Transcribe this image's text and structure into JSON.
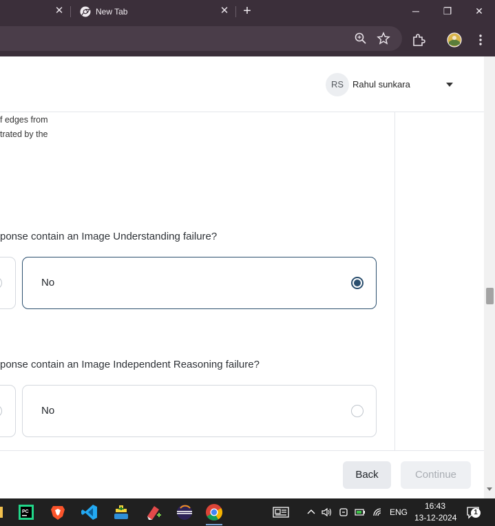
{
  "browser": {
    "tab_close_glyph": "✕",
    "active_tab_title": "New Tab",
    "new_tab_glyph": "+",
    "window_minimize_glyph": "─",
    "window_restore_glyph": "❐",
    "window_close_glyph": "✕",
    "toolbar_icons": [
      "zoom-icon",
      "bookmark-star-icon",
      "extensions-icon",
      "profile-avatar-icon",
      "menu-kebab-icon"
    ]
  },
  "header": {
    "avatar_initials": "RS",
    "user_name": "Rahul sunkara"
  },
  "content": {
    "paragraph_lines": [
      "f edges from",
      "trated by the"
    ],
    "questions": [
      {
        "text": "ponse contain an Image Understanding failure?",
        "options": [
          {
            "label": "",
            "selected": false
          },
          {
            "label": "No",
            "selected": true
          }
        ]
      },
      {
        "text": "ponse contain an Image Independent Reasoning failure?",
        "options": [
          {
            "label": "",
            "selected": false
          },
          {
            "label": "No",
            "selected": false
          }
        ]
      }
    ]
  },
  "footer": {
    "back_label": "Back",
    "continue_label": "Continue"
  },
  "taskbar": {
    "apps": [
      "file-explorer-icon",
      "pycharm-icon",
      "brave-icon",
      "vscode-icon",
      "game-icon",
      "notes-icon",
      "eclipse-icon",
      "chrome-icon"
    ],
    "tray_language": "ENG",
    "time": "16:43",
    "date": "13-12-2024",
    "notification_count": "1"
  },
  "colors": {
    "chrome_frame": "#3b2f3a",
    "accent": "#2b4f6e",
    "taskbar": "#202020"
  }
}
